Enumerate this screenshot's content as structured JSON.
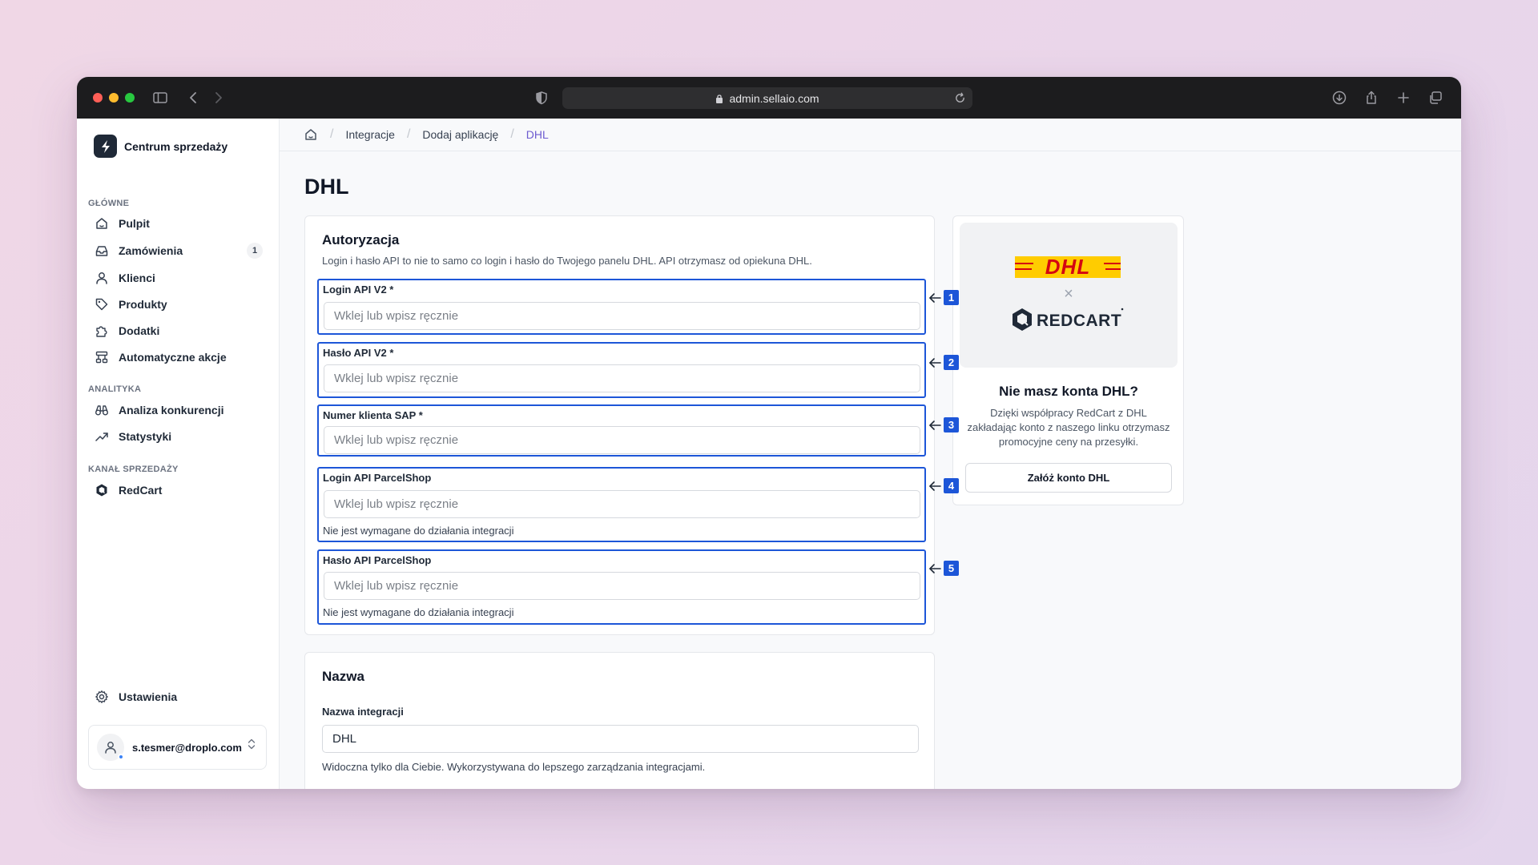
{
  "browser": {
    "url": "admin.sellaio.com"
  },
  "sidebar": {
    "brand": "Centrum sprzedaży",
    "sections": [
      {
        "label": "GŁÓWNE",
        "items": [
          {
            "label": "Pulpit",
            "icon": "home-icon"
          },
          {
            "label": "Zamówienia",
            "icon": "inbox-icon",
            "badge": "1"
          },
          {
            "label": "Klienci",
            "icon": "user-icon"
          },
          {
            "label": "Produkty",
            "icon": "tag-icon"
          },
          {
            "label": "Dodatki",
            "icon": "puzzle-icon"
          },
          {
            "label": "Automatyczne akcje",
            "icon": "workflow-icon"
          }
        ]
      },
      {
        "label": "ANALITYKA",
        "items": [
          {
            "label": "Analiza konkurencji",
            "icon": "binoculars-icon"
          },
          {
            "label": "Statystyki",
            "icon": "trending-up-icon"
          }
        ]
      },
      {
        "label": "KANAŁ SPRZEDAŻY",
        "items": [
          {
            "label": "RedCart",
            "icon": "redcart-icon"
          }
        ]
      }
    ],
    "settings_label": "Ustawienia",
    "user_email": "s.tesmer@droplo.com"
  },
  "breadcrumb": {
    "items": [
      "Integracje",
      "Dodaj aplikację"
    ],
    "current": "DHL"
  },
  "page": {
    "title": "DHL"
  },
  "auth_card": {
    "title": "Autoryzacja",
    "description": "Login i hasło API to nie to samo co login i hasło do Twojego panelu DHL. API otrzymasz od opiekuna DHL.",
    "fields": [
      {
        "label": "Login API V2 *",
        "placeholder": "Wklej lub wpisz ręcznie",
        "marker": "1"
      },
      {
        "label": "Hasło API V2 *",
        "placeholder": "Wklej lub wpisz ręcznie",
        "marker": "2"
      },
      {
        "label": "Numer klienta SAP *",
        "placeholder": "Wklej lub wpisz ręcznie",
        "marker": "3"
      },
      {
        "label": "Login API ParcelShop",
        "placeholder": "Wklej lub wpisz ręcznie",
        "hint": "Nie jest wymagane do działania integracji",
        "marker": "4"
      },
      {
        "label": "Hasło API ParcelShop",
        "placeholder": "Wklej lub wpisz ręcznie",
        "hint": "Nie jest wymagane do działania integracji",
        "marker": "5"
      }
    ]
  },
  "name_card": {
    "title": "Nazwa",
    "field_label": "Nazwa integracji",
    "field_value": "DHL",
    "hint": "Widoczna tylko dla Ciebie. Wykorzystywana do lepszego zarządzania integracjami."
  },
  "promo": {
    "logo_dhl": "DHL",
    "logo_cross": "×",
    "logo_redcart": "REDCART",
    "title": "Nie masz konta DHL?",
    "text": "Dzięki współpracy RedCart z DHL zakładając konto z naszego linku otrzymasz promocyjne ceny na przesyłki.",
    "button": "Załóż konto DHL"
  },
  "colors": {
    "accent_blue": "#1d56d8",
    "dhl_yellow": "#fc0",
    "dhl_red": "#d40511",
    "breadcrumb_active": "#6d5bd0"
  }
}
